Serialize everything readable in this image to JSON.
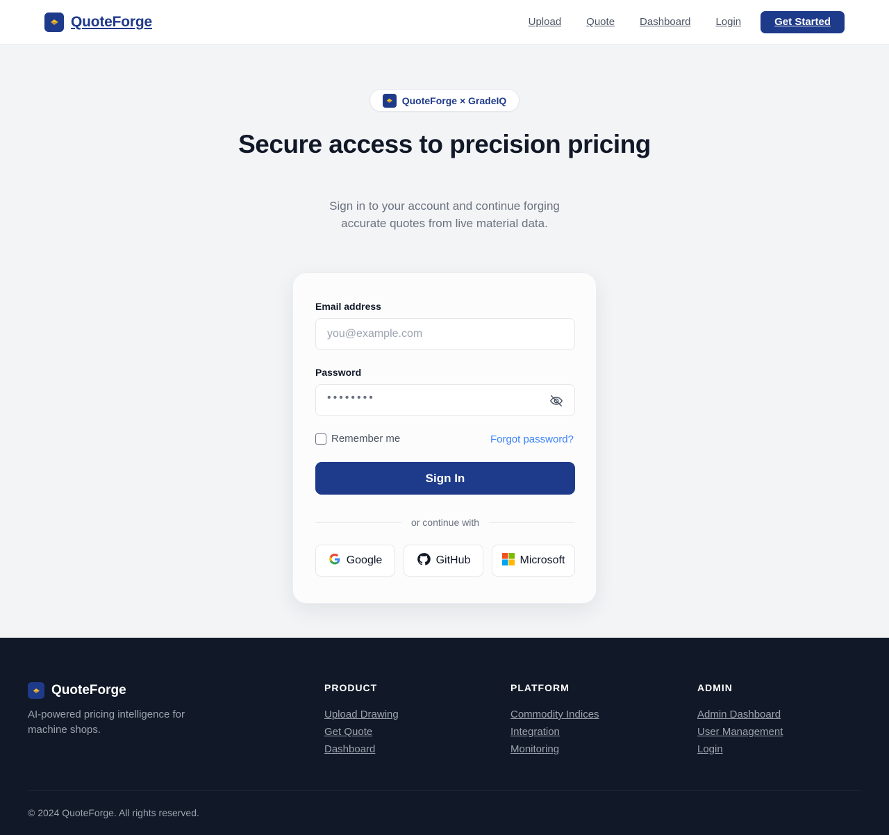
{
  "header": {
    "brand": "QuoteForge",
    "nav": [
      "Upload",
      "Quote",
      "Dashboard",
      "Login"
    ],
    "cta": "Get Started"
  },
  "hero": {
    "badge": "QuoteForge × GradeIQ",
    "title": "Secure access to precision pricing",
    "subtitle": "Sign in to your account and continue forging accurate quotes from live material data."
  },
  "form": {
    "email_label": "Email address",
    "email_placeholder": "you@example.com",
    "password_label": "Password",
    "password_value": "••••••••",
    "remember": "Remember me",
    "forgot": "Forgot password?",
    "submit": "Sign In",
    "divider": "or continue with",
    "social": [
      "Google",
      "GitHub",
      "Microsoft"
    ]
  },
  "footer": {
    "brand": "QuoteForge",
    "tagline": "AI-powered pricing intelligence for machine shops.",
    "columns": [
      {
        "title": "PRODUCT",
        "links": [
          "Upload Drawing",
          "Get Quote",
          "Dashboard"
        ]
      },
      {
        "title": "PLATFORM",
        "links": [
          "Commodity Indices",
          "Integration",
          "Monitoring"
        ]
      },
      {
        "title": "ADMIN",
        "links": [
          "Admin Dashboard",
          "User Management",
          "Login"
        ]
      }
    ],
    "copyright": "© 2024 QuoteForge. All rights reserved."
  },
  "colors": {
    "brand": "#1e3a8a",
    "accent": "#fbbf24",
    "link": "#3b82f6",
    "footer_bg": "#111827"
  }
}
